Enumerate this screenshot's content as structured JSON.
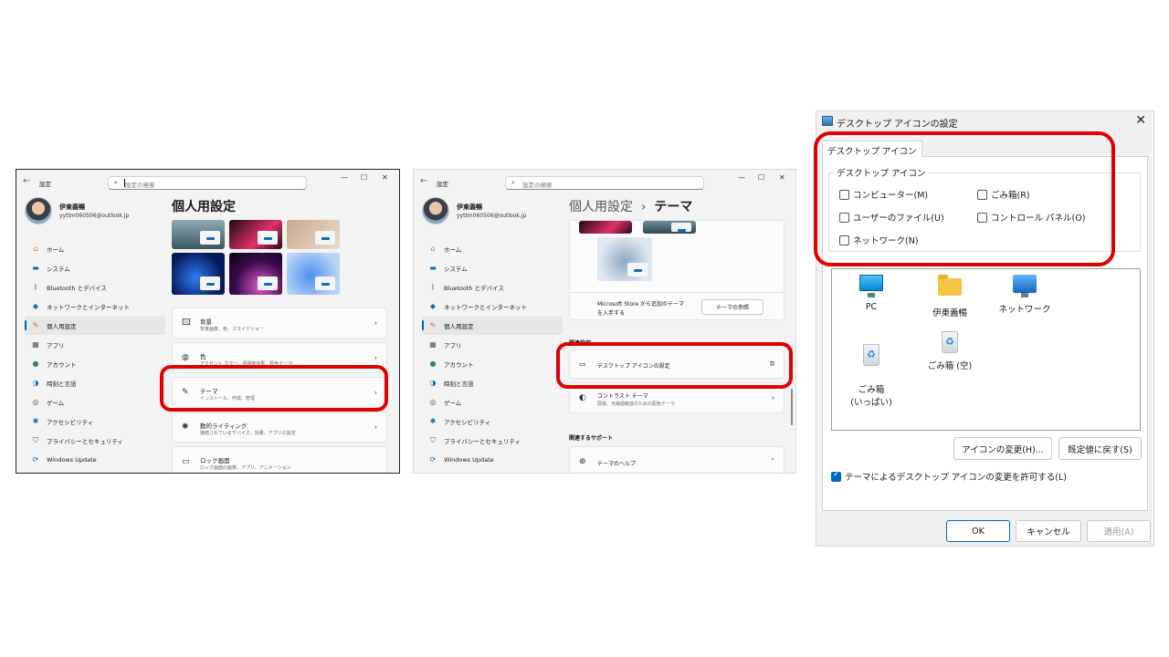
{
  "panel1": {
    "app_title": "設定",
    "search_placeholder": "設定の検索",
    "user_name": "伊東義暢",
    "user_email": "yyttm060506@outlook.jp",
    "page_title": "個人用設定",
    "nav": [
      {
        "label": "ホーム",
        "icon": "home-icon"
      },
      {
        "label": "システム",
        "icon": "system-icon"
      },
      {
        "label": "Bluetooth とデバイス",
        "icon": "bluetooth-icon"
      },
      {
        "label": "ネットワークとインターネット",
        "icon": "network-icon"
      },
      {
        "label": "個人用設定",
        "icon": "brush-icon"
      },
      {
        "label": "アプリ",
        "icon": "apps-icon"
      },
      {
        "label": "アカウント",
        "icon": "account-icon"
      },
      {
        "label": "時刻と言語",
        "icon": "time-language-icon"
      },
      {
        "label": "ゲーム",
        "icon": "gaming-icon"
      },
      {
        "label": "アクセシビリティ",
        "icon": "accessibility-icon"
      },
      {
        "label": "プライバシーとセキュリティ",
        "icon": "shield-icon"
      },
      {
        "label": "Windows Update",
        "icon": "update-icon"
      }
    ],
    "cards": [
      {
        "title": "背景",
        "sub": "背景画像、色、スライドショー",
        "icon": "image-icon"
      },
      {
        "title": "色",
        "sub": "アクセント カラー、透明度効果、配色テーマ",
        "icon": "palette-icon"
      },
      {
        "title": "テーマ",
        "sub": "インストール、作成、管理",
        "icon": "pen-icon"
      },
      {
        "title": "動的ライティング",
        "sub": "接続されているデバイス、効果、アプリの設定",
        "icon": "sun-icon"
      },
      {
        "title": "ロック画面",
        "sub": "ロック画面の画像、アプリ、アニメーション",
        "icon": "lock-screen-icon"
      }
    ]
  },
  "panel2": {
    "app_title": "設定",
    "search_placeholder": "設定の検索",
    "user_name": "伊東義暢",
    "user_email": "yyttm060506@outlook.jp",
    "breadcrumb_parent": "個人用設定",
    "breadcrumb_sep": "›",
    "page_title": "テーマ",
    "nav": [
      {
        "label": "ホーム"
      },
      {
        "label": "システム"
      },
      {
        "label": "Bluetooth とデバイス"
      },
      {
        "label": "ネットワークとインターネット"
      },
      {
        "label": "個人用設定"
      },
      {
        "label": "アプリ"
      },
      {
        "label": "アカウント"
      },
      {
        "label": "時刻と言語"
      },
      {
        "label": "ゲーム"
      },
      {
        "label": "アクセシビリティ"
      },
      {
        "label": "プライバシーとセキュリティ"
      },
      {
        "label": "Windows Update"
      }
    ],
    "store_text_1": "Microsoft Store から追加のテーマ",
    "store_text_2": "を入手する",
    "browse_button": "テーマの参照",
    "related_settings": "関連設定",
    "desktop_icon_settings": "デスクトップ アイコンの設定",
    "contrast_title": "コントラスト テーマ",
    "contrast_sub": "弱視、光線過敏症のための配色テーマ",
    "related_support": "関連するサポート",
    "theme_help": "テーマのヘルプ"
  },
  "dialog": {
    "title": "デスクトップ アイコンの設定",
    "tab": "デスクトップ アイコン",
    "group_label": "デスクトップ アイコン",
    "checkboxes": [
      {
        "label": "コンピューター(M)",
        "checked": false
      },
      {
        "label": "ごみ箱(R)",
        "checked": false
      },
      {
        "label": "ユーザーのファイル(U)",
        "checked": false
      },
      {
        "label": "コントロール パネル(O)",
        "checked": false
      },
      {
        "label": "ネットワーク(N)",
        "checked": false
      }
    ],
    "icons": [
      {
        "label": "PC",
        "icon": "pc-icon"
      },
      {
        "label": "伊東義暢",
        "icon": "folder-icon"
      },
      {
        "label": "ネットワーク",
        "icon": "network-icon"
      },
      {
        "label": "ごみ箱\n(いっぱい)",
        "icon": "recycle-bin-full-icon"
      },
      {
        "label": "ごみ箱 (空)",
        "icon": "recycle-bin-empty-icon"
      }
    ],
    "change_icon_button": "アイコンの変更(H)...",
    "restore_default_button": "既定値に戻す(S)",
    "allow_themes_label": "テーマによるデスクトップ アイコンの変更を許可する(L)",
    "allow_themes_checked": true,
    "ok_button": "OK",
    "cancel_button": "キャンセル",
    "apply_button": "適用(A)"
  },
  "colors": {
    "highlight_red": "#e00000",
    "accent_blue": "#0067c0"
  }
}
